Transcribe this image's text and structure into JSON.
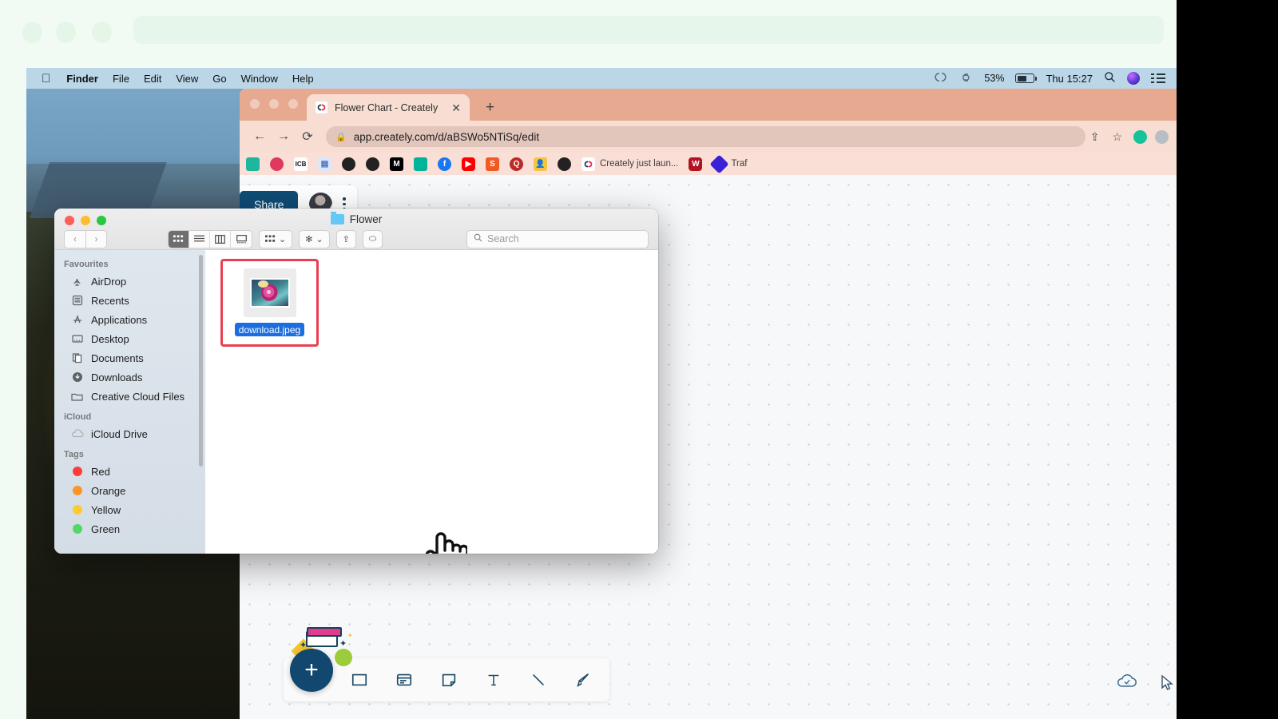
{
  "menubar": {
    "apple_icon": "apple-logo-icon",
    "items": [
      "Finder",
      "File",
      "Edit",
      "View",
      "Go",
      "Window",
      "Help"
    ],
    "status": {
      "creative_cloud_icon": "creative-cloud-icon",
      "dropbox_icon": "dropbox-icon",
      "battery_percent": "53%",
      "battery_icon": "battery-icon",
      "clock": "Thu 15:27",
      "search_icon": "spotlight-search-icon",
      "siri_icon": "siri-icon",
      "control_center_icon": "control-center-icon"
    }
  },
  "browser": {
    "tab": {
      "favicon": "creately-logo-icon",
      "title": "Flower Chart - Creately",
      "close_icon": "close-icon"
    },
    "new_tab_icon": "new-tab-plus-icon",
    "nav": {
      "back_icon": "arrow-back-icon",
      "forward_icon": "arrow-forward-icon",
      "reload_icon": "reload-icon"
    },
    "omnibox": {
      "lock_icon": "lock-icon",
      "url": "app.creately.com/d/aBSWo5NTiSq/edit",
      "share_icon": "share-icon",
      "bookmark_star_icon": "star-icon"
    },
    "extensions": [
      {
        "name": "grammarly-extension-icon",
        "color": "#15c39a"
      },
      {
        "name": "recycle-extension-icon",
        "color": "#9aa0a6"
      }
    ],
    "bookmarks": [
      {
        "name": "bookmark-shield",
        "color": "#1fb6a0",
        "glyph": ""
      },
      {
        "name": "bookmark-target",
        "color": "#e0395e",
        "glyph": ""
      },
      {
        "name": "bookmark-icb",
        "color": "#ffffff",
        "glyph": "ICB"
      },
      {
        "name": "bookmark-library",
        "color": "#dbe7fb",
        "glyph": ""
      },
      {
        "name": "bookmark-globe-dark",
        "color": "#222222",
        "glyph": ""
      },
      {
        "name": "bookmark-globe-dark-2",
        "color": "#222222",
        "glyph": ""
      },
      {
        "name": "bookmark-medium",
        "color": "#000000",
        "glyph": "M"
      },
      {
        "name": "bookmark-teal-square",
        "color": "#00b39b",
        "glyph": ""
      },
      {
        "name": "bookmark-facebook",
        "color": "#1877f2",
        "glyph": "f"
      },
      {
        "name": "bookmark-youtube",
        "color": "#ff0000",
        "glyph": ""
      },
      {
        "name": "bookmark-semrush",
        "color": "#f15a24",
        "glyph": "S"
      },
      {
        "name": "bookmark-quora",
        "color": "#b92b27",
        "glyph": "Q"
      },
      {
        "name": "bookmark-person",
        "color": "#f5c542",
        "glyph": ""
      },
      {
        "name": "bookmark-globe-dark-3",
        "color": "#222222",
        "glyph": ""
      }
    ],
    "bookmark_text_items": [
      {
        "icon": "creately-logo-icon",
        "label": "Creately just laun..."
      },
      {
        "icon": "bookmark-w-icon",
        "label": ""
      },
      {
        "icon": "bookmark-diamond-icon",
        "label": "Traf"
      }
    ]
  },
  "creately": {
    "share_label": "Share",
    "avatar": "user-avatar",
    "more_icon": "kebab-menu-icon",
    "toolbar_tools": [
      "shape-rectangle-icon",
      "card-icon",
      "sticky-note-icon",
      "text-tool-icon",
      "line-tool-icon",
      "pen-freehand-icon"
    ],
    "fab_label": "+",
    "cloud_status_icon": "cloud-saved-icon",
    "cursor_icon": "pointer-cursor-icon"
  },
  "finder": {
    "window_controls": [
      "close-button",
      "minimize-button",
      "zoom-button"
    ],
    "title": "Flower",
    "title_icon": "folder-icon",
    "toolbar": {
      "back_icon": "chevron-left-icon",
      "forward_icon": "chevron-right-icon",
      "view_modes": [
        {
          "name": "icon-view",
          "active": true
        },
        {
          "name": "list-view",
          "active": false
        },
        {
          "name": "column-view",
          "active": false
        },
        {
          "name": "gallery-view",
          "active": false
        }
      ],
      "group_icon": "group-by-icon",
      "action_icon": "gear-actions-icon",
      "share_icon": "share-icon",
      "tag_icon": "tag-icon"
    },
    "search": {
      "icon": "search-icon",
      "placeholder": "Search",
      "value": ""
    },
    "sidebar": {
      "sections": [
        {
          "header": "Favourites",
          "items": [
            {
              "label": "AirDrop",
              "icon": "airdrop-icon"
            },
            {
              "label": "Recents",
              "icon": "recents-icon"
            },
            {
              "label": "Applications",
              "icon": "applications-icon"
            },
            {
              "label": "Desktop",
              "icon": "desktop-icon"
            },
            {
              "label": "Documents",
              "icon": "documents-icon"
            },
            {
              "label": "Downloads",
              "icon": "downloads-icon"
            },
            {
              "label": "Creative Cloud Files",
              "icon": "folder-icon"
            }
          ]
        },
        {
          "header": "iCloud",
          "items": [
            {
              "label": "iCloud Drive",
              "icon": "cloud-icon"
            }
          ]
        },
        {
          "header": "Tags",
          "items": [
            {
              "label": "Red",
              "icon": "tag-dot-icon",
              "color": "#fc3d39"
            },
            {
              "label": "Orange",
              "icon": "tag-dot-icon",
              "color": "#fd9426"
            },
            {
              "label": "Yellow",
              "icon": "tag-dot-icon",
              "color": "#fecb2e"
            },
            {
              "label": "Green",
              "icon": "tag-dot-icon",
              "color": "#53d769"
            }
          ]
        }
      ]
    },
    "files": [
      {
        "name": "download.jpeg",
        "thumbnail": "rose-flower-image",
        "selected": true,
        "highlighted": true
      }
    ],
    "pointer": "hand-pointer-cursor"
  }
}
